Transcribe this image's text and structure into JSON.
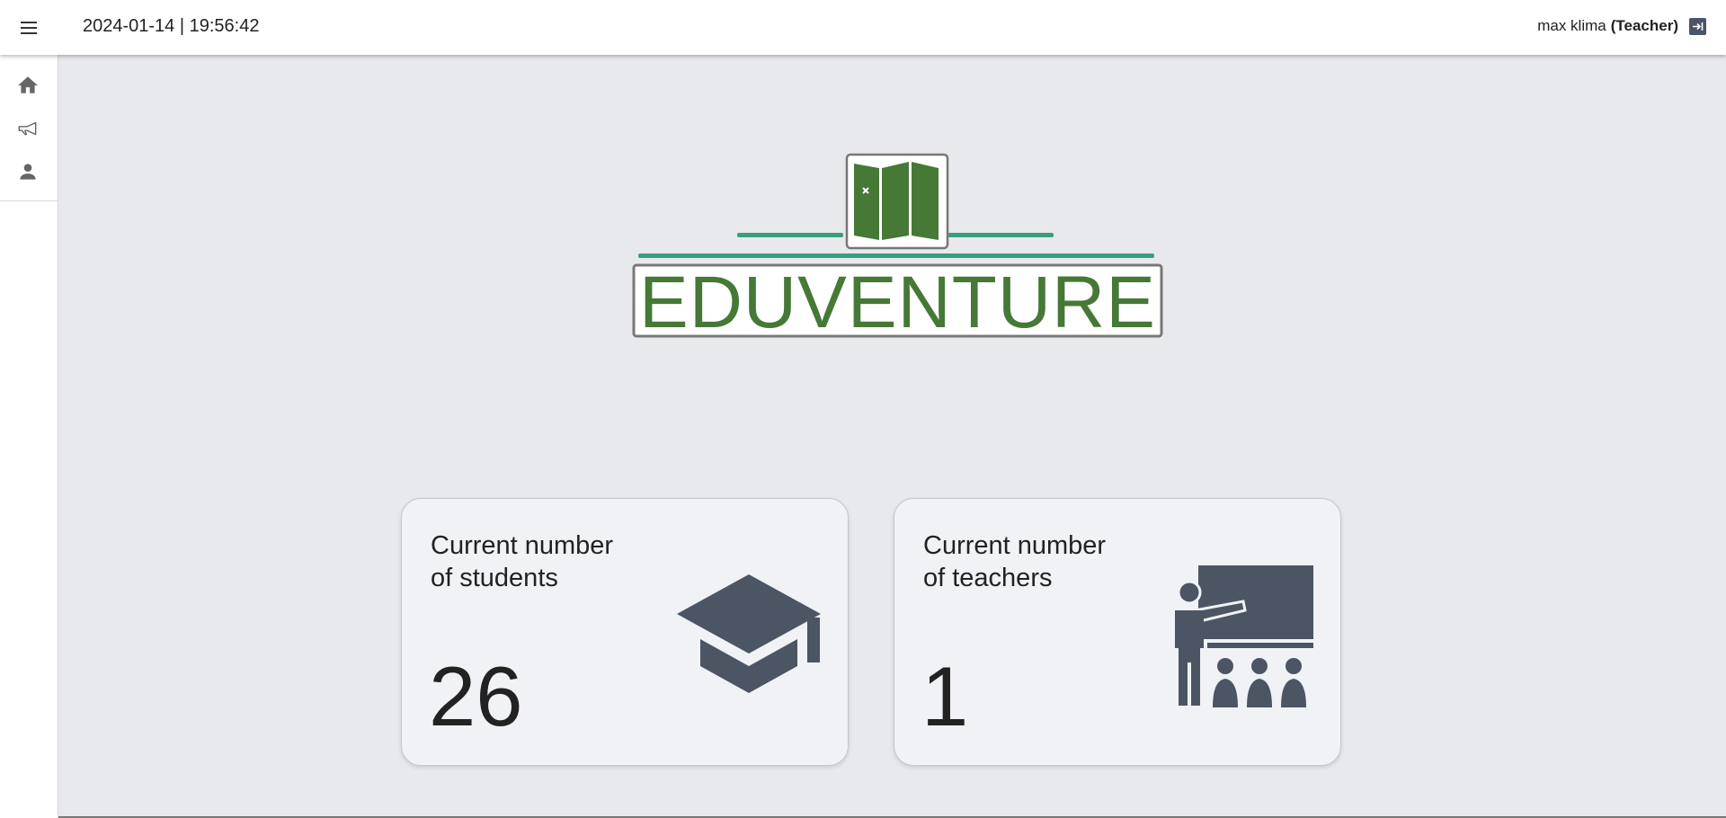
{
  "header": {
    "datetime": "2024-01-14 | 19:56:42",
    "user_name": "max klima",
    "user_role": "(Teacher)"
  },
  "sidebar": {
    "items": [
      {
        "icon": "home-icon"
      },
      {
        "icon": "megaphone-icon"
      },
      {
        "icon": "person-icon"
      }
    ]
  },
  "logo": {
    "text": "EDUVENTURE"
  },
  "cards": [
    {
      "title_line1": "Current number",
      "title_line2": "of students",
      "value": "26",
      "icon": "graduation-cap-icon"
    },
    {
      "title_line1": "Current number",
      "title_line2": "of teachers",
      "value": "1",
      "icon": "teacher-blackboard-icon"
    }
  ],
  "colors": {
    "accent_green": "#3a9e7e",
    "logo_green": "#467836",
    "icon_slate": "#4b5563",
    "background": "#e8e9ed"
  }
}
